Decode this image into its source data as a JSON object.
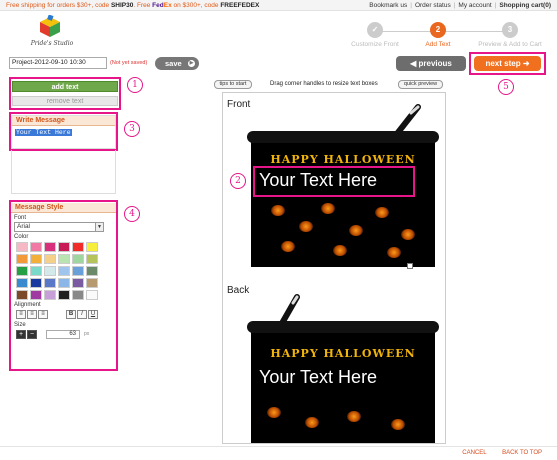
{
  "topbar": {
    "promo_part1": "Free shipping for orders $30+, code ",
    "promo_code1": "SHIP30",
    "promo_part2": ". Free ",
    "fedex_fed": "Fed",
    "fedex_ex": "Ex",
    "promo_part3": " on $300+, code ",
    "promo_code2": "FREEFEDEX",
    "links": [
      "Bookmark us",
      "Order status",
      "My account"
    ],
    "cart": "Shopping cart(0)"
  },
  "logo": {
    "name": "Pride's Studio"
  },
  "steps": [
    {
      "number": "✓",
      "label": "Customize Front",
      "state": "done"
    },
    {
      "number": "2",
      "label": "Add Text",
      "state": "active"
    },
    {
      "number": "3",
      "label": "Preview & Add to Cart",
      "state": "todo"
    }
  ],
  "project": {
    "value": "Project-2012-09-10 10:30",
    "status": "(Not yet saved)"
  },
  "toolbar": {
    "save_label": "save",
    "previous_label": "previous",
    "next_label": "next step"
  },
  "text_tools": {
    "add_label": "add text",
    "remove_label": "remove text"
  },
  "write_message": {
    "heading": "Write Message",
    "value": "Your Text Here"
  },
  "message_style": {
    "heading": "Message Style",
    "font_label": "Font",
    "font_value": "Arial",
    "color_label": "Color",
    "colors": [
      "#f6b8c4",
      "#f07aa3",
      "#d9307e",
      "#c81a55",
      "#f12a2a",
      "#f6ee3a",
      "#f29a3a",
      "#f2b03a",
      "#f4d08a",
      "#b9e4b2",
      "#9fd6a0",
      "#b4c35a",
      "#25a044",
      "#7ad9c9",
      "#d4e9e9",
      "#9fc4ee",
      "#6aa0d9",
      "#6a8a6a",
      "#3a8acf",
      "#1a3aa0",
      "#5a78c8",
      "#8ab6e8",
      "#7a5aa0",
      "#b89a70",
      "#7a4a2a",
      "#a03aa0",
      "#c8a0d8",
      "#202020",
      "#888888",
      "#fafafa"
    ],
    "alignment_label": "Alignment",
    "bold": "B",
    "italic": "I",
    "underline": "U",
    "size_label": "Size",
    "size_value": "63",
    "size_unit": "px",
    "plus": "+",
    "minus": "−"
  },
  "canvas": {
    "tips_label": "tips to start",
    "hint": "Drag corner handles to resize text boxes",
    "quick_preview_label": "quick preview",
    "front_label": "Front",
    "back_label": "Back",
    "design_title": "HAPPY HALLOWEEN",
    "front_text": "Your Text Here",
    "back_text": "Your Text Here"
  },
  "callouts": [
    "1",
    "2",
    "3",
    "4",
    "5"
  ],
  "footer": {
    "cancel": "CANCEL",
    "back_to_top": "BACK TO TOP"
  },
  "colors": {
    "accent": "#f07020",
    "highlight": "#e6168a",
    "add_green": "#6fa84a"
  }
}
